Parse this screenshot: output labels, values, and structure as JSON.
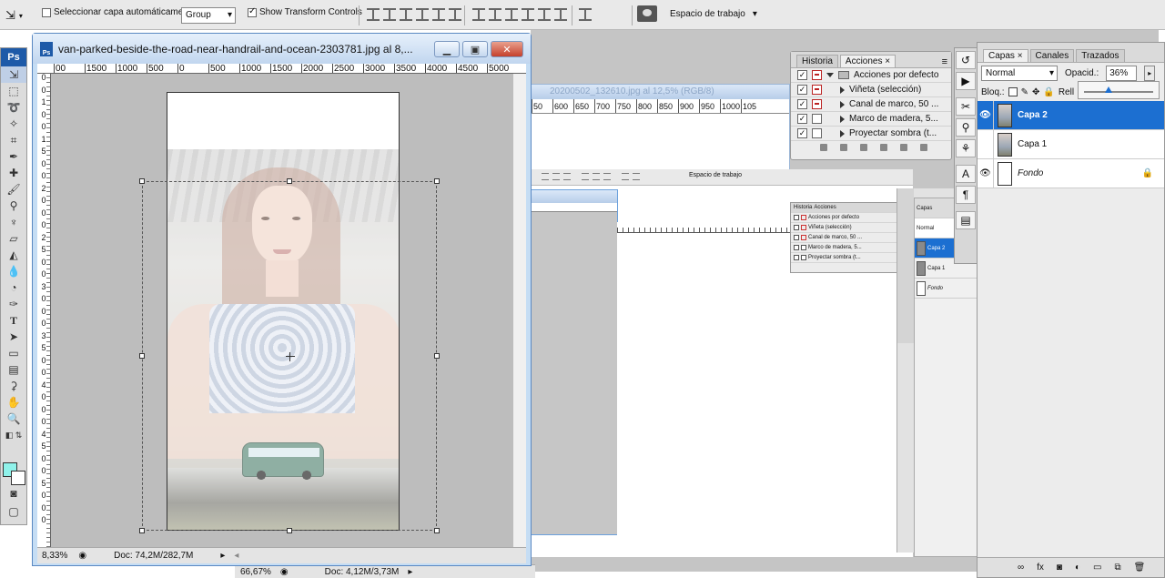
{
  "options_bar": {
    "auto_select_label": "Seleccionar capa automáticamente",
    "auto_select_target": "Group",
    "show_transform_label": "Show Transform Controls",
    "workspace_label": "Espacio de trabajo"
  },
  "toolbox": {
    "logo": "Ps",
    "foreground_color": "#8ff2ea",
    "background_color": "#ffffff"
  },
  "document": {
    "title": "van-parked-beside-the-road-near-handrail-and-ocean-2303781.jpg al 8,...",
    "ruler_labels": [
      "00",
      "1500",
      "1000",
      "500",
      "0",
      "500",
      "1000",
      "1500",
      "2000",
      "2500",
      "3000",
      "3500",
      "4000",
      "4500",
      "5000"
    ],
    "vertical_ruler_labels": [
      "0",
      "0",
      "1",
      "0",
      "0",
      "1",
      "5",
      "0",
      "0",
      "2",
      "0",
      "0",
      "0",
      "2",
      "5",
      "0",
      "0",
      "3",
      "0",
      "0",
      "0",
      "3",
      "5",
      "0",
      "0",
      "4",
      "0",
      "0",
      "0",
      "4",
      "5",
      "0",
      "0",
      "5",
      "0",
      "0",
      "0"
    ],
    "zoom": "8,33%",
    "doc_size": "Doc: 74,2M/282,7M"
  },
  "background_doc": {
    "title": "20200502_132610.jpg al 12,5% (RGB/8)",
    "ruler_labels": [
      "50",
      "600",
      "650",
      "700",
      "750",
      "800",
      "850",
      "900",
      "950",
      "1000",
      "105"
    ]
  },
  "nested_status": {
    "zoom": "66,67%",
    "doc_size": "Doc: 4,12M/3,73M"
  },
  "history_panel": {
    "tabs": [
      "Historia",
      "Acciones"
    ],
    "rows": [
      {
        "label": "Acciones por defecto",
        "type": "folder"
      },
      {
        "label": "Viñeta (selección)",
        "type": "action"
      },
      {
        "label": "Canal de marco, 50 ...",
        "type": "action"
      },
      {
        "label": "Marco de madera, 5...",
        "type": "action"
      },
      {
        "label": "Proyectar sombra (t...",
        "type": "action"
      }
    ]
  },
  "layers_panel": {
    "tabs": [
      "Capas",
      "Canales",
      "Trazados"
    ],
    "blend_mode": "Normal",
    "opacity_label": "Opacid.:",
    "opacity_value": "36%",
    "opacity_fraction": 0.36,
    "lock_label": "Bloq.:",
    "fill_label": "Rell",
    "layers": [
      {
        "name": "Capa 2",
        "selected": true,
        "visible": true
      },
      {
        "name": "Capa 1",
        "selected": false,
        "visible": false
      },
      {
        "name": "Fondo",
        "selected": false,
        "visible": true,
        "locked": true
      }
    ]
  }
}
